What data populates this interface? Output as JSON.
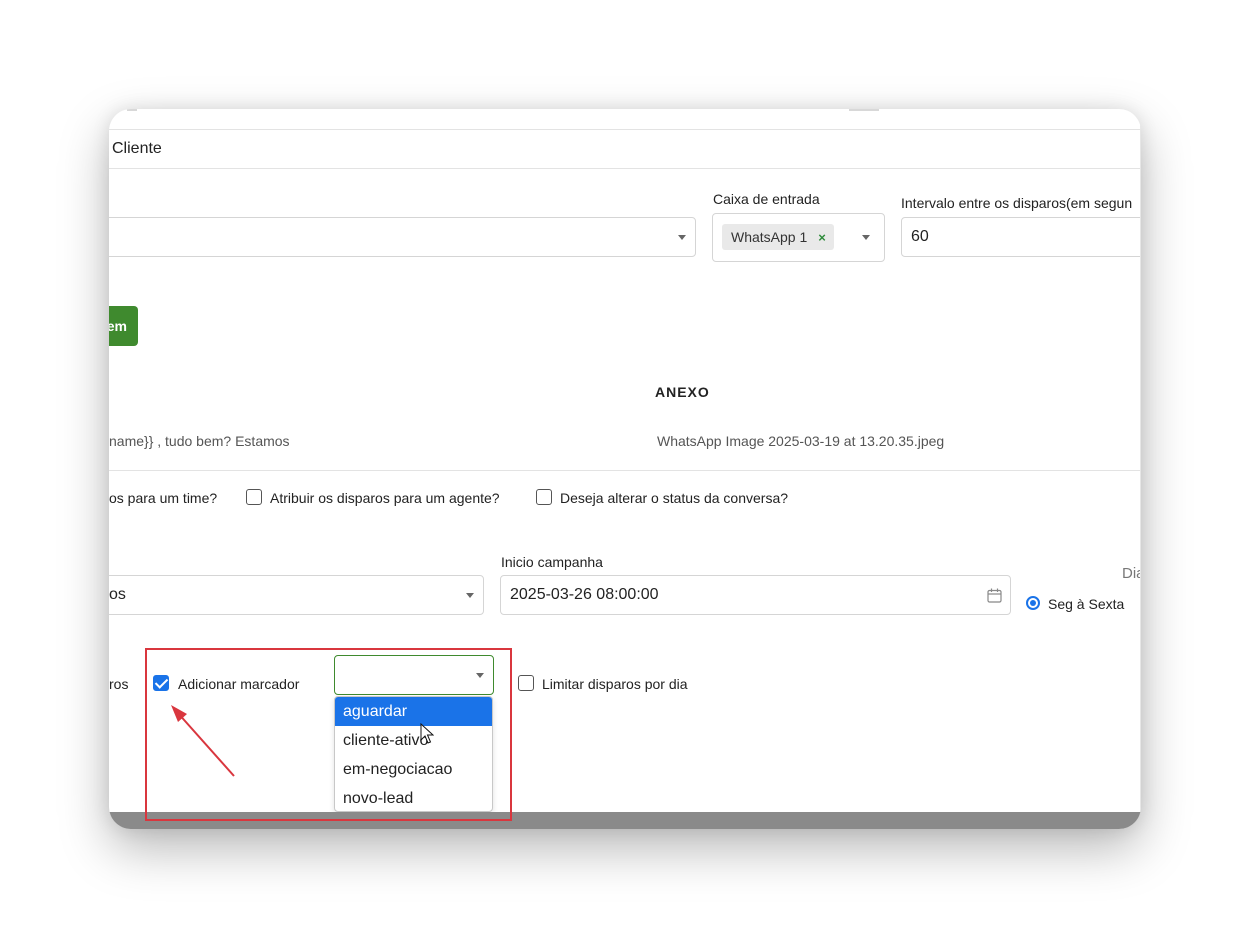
{
  "header": {
    "title": "Cliente"
  },
  "form": {
    "inbox_label": "Caixa de entrada",
    "inbox_tag": "WhatsApp 1",
    "interval_label": "Intervalo entre os disparos(em segun",
    "interval_value": "60",
    "green_button_label": "em"
  },
  "message": {
    "anexo_title": "ANEXO",
    "text_preview": "name}} , tudo bem? Estamos",
    "attachment_name": "WhatsApp Image 2025-03-19 at 13.20.35.jpeg"
  },
  "options": {
    "team_label": "os para um time?",
    "agent_label": "Atribuir os disparos para um agente?",
    "status_label": "Deseja alterar o status da conversa?"
  },
  "schedule": {
    "left_select_value": "os",
    "start_label": "Inicio campanha",
    "start_value": "2025-03-26 08:00:00",
    "days_label": "Dia",
    "days_option": "Seg à Sexta"
  },
  "bottom": {
    "left_fragment": "ros",
    "add_marker_label": "Adicionar marcador",
    "add_marker_checked": true,
    "limit_label": "Limitar disparos por dia",
    "limit_checked": false
  },
  "marker_dropdown": {
    "options": [
      "aguardar",
      "cliente-ativo",
      "em-negociacao",
      "novo-lead"
    ],
    "highlighted": "aguardar"
  },
  "colors": {
    "accent": "#1a73e8",
    "green_button": "#3f8a2e",
    "annotation_red": "#d9363e"
  }
}
